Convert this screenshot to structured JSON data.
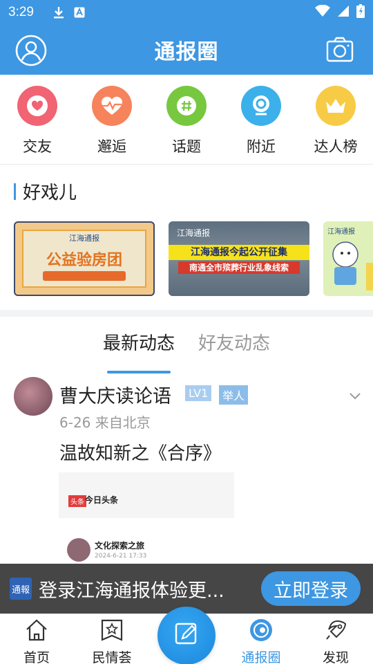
{
  "status_bar": {
    "time": "3:29",
    "icons": [
      "download-icon",
      "a-notification-icon",
      "wifi-icon",
      "signal-icon",
      "battery-icon"
    ]
  },
  "header": {
    "title": "通报圈",
    "left_icon": "user-avatar-icon",
    "right_icon": "camera-icon"
  },
  "categories": [
    {
      "label": "交友",
      "icon": "heart-icon",
      "color": "#f06473"
    },
    {
      "label": "邂逅",
      "icon": "heartbeat-icon",
      "color": "#f7835c"
    },
    {
      "label": "话题",
      "icon": "hashtag-icon",
      "color": "#77c83f"
    },
    {
      "label": "附近",
      "icon": "location-camera-icon",
      "color": "#3cb0ea"
    },
    {
      "label": "达人榜",
      "icon": "crown-icon",
      "color": "#f7cb45"
    }
  ],
  "good_shows": {
    "title": "好戏儿",
    "banners": [
      {
        "brand": "江海通报",
        "title": "公益验房团"
      },
      {
        "brand": "江海通报",
        "headline": "江海通报今起公开征集",
        "subline": "南通全市殡葬行业乱象线索"
      },
      {
        "brand": "江海通报"
      }
    ]
  },
  "tabs": [
    {
      "label": "最新动态",
      "active": true
    },
    {
      "label": "好友动态",
      "active": false
    }
  ],
  "post": {
    "user": "曹大庆读论语",
    "level": "LV1",
    "role": "举人",
    "meta": "6-26 来自北京",
    "text": "温故知新之《合序》",
    "preview": {
      "source_badge": "头条",
      "source_name": "今日头条",
      "author": "文化探索之旅",
      "date": "2024-6-21 17:33"
    }
  },
  "login_banner": {
    "logo": "通報",
    "message": "登录江海通报体验更...",
    "button": "立即登录"
  },
  "bottom_nav": [
    {
      "label": "首页",
      "icon": "home-icon",
      "active": false
    },
    {
      "label": "民情荟",
      "icon": "star-badge-icon",
      "active": false
    },
    {
      "label": "通报圈",
      "icon": "circle-eye-icon",
      "active": true
    },
    {
      "label": "发现",
      "icon": "rocket-icon",
      "active": false
    }
  ],
  "fab_icon": "edit-icon",
  "colors": {
    "primary": "#3d97e2",
    "text": "#222222",
    "muted": "#999999"
  }
}
